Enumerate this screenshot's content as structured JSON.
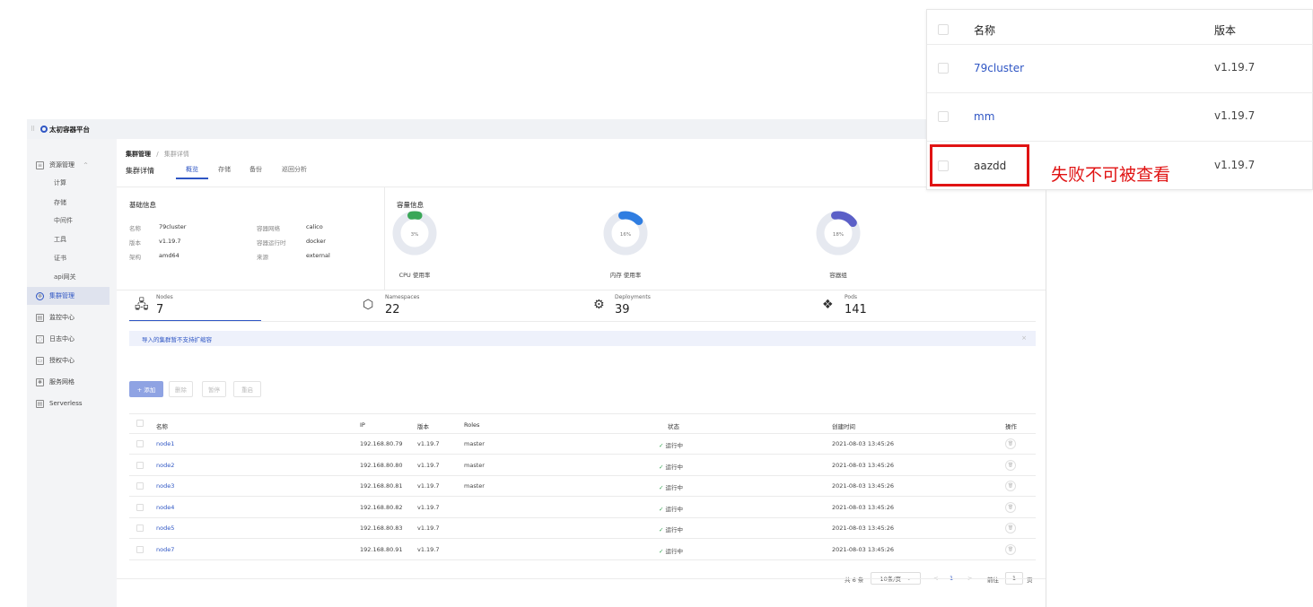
{
  "app": {
    "title": "太初容器平台"
  },
  "sidebar": {
    "items": [
      {
        "label": "资源管理",
        "icon": "sliders-icon",
        "expanded": true
      },
      {
        "label": "计算",
        "sub": true
      },
      {
        "label": "存储",
        "sub": true
      },
      {
        "label": "中间件",
        "sub": true
      },
      {
        "label": "工具",
        "sub": true
      },
      {
        "label": "证书",
        "sub": true
      },
      {
        "label": "api网关",
        "sub": true
      },
      {
        "label": "集群管理",
        "icon": "cluster-icon",
        "active": true
      },
      {
        "label": "监控中心",
        "icon": "monitor-icon"
      },
      {
        "label": "日志中心",
        "icon": "bell-icon"
      },
      {
        "label": "授权中心",
        "icon": "key-icon"
      },
      {
        "label": "服务网格",
        "icon": "mesh-icon"
      },
      {
        "label": "Serverless",
        "icon": "serverless-icon"
      }
    ]
  },
  "breadcrumb": {
    "root": "集群管理",
    "separator": "/",
    "current": "集群详情"
  },
  "page": {
    "title": "集群详情",
    "tabs": [
      "概览",
      "存储",
      "备份",
      "巡回分析"
    ],
    "active_tab": 0
  },
  "basic_info": {
    "title": "基础信息",
    "fields": [
      {
        "k": "名称",
        "v": "79cluster"
      },
      {
        "k": "版本",
        "v": "v1.19.7"
      },
      {
        "k": "架构",
        "v": "amd64"
      },
      {
        "k": "容器网络",
        "v": "calico"
      },
      {
        "k": "容器运行时",
        "v": "docker"
      },
      {
        "k": "来源",
        "v": "external"
      }
    ]
  },
  "capacity": {
    "title": "容量信息",
    "donuts": [
      {
        "label": "CPU 使用率",
        "pct_text": "3%",
        "value": 0.03,
        "color": "#3aa757"
      },
      {
        "label": "内存 使用率",
        "pct_text": "16%",
        "value": 0.16,
        "color": "#2f7de1"
      },
      {
        "label": "容器组",
        "pct_text": "18%",
        "value": 0.18,
        "color": "#5b5fc7"
      }
    ]
  },
  "stats": [
    {
      "label": "Nodes",
      "value": "7",
      "icon": "nodes-icon"
    },
    {
      "label": "Namespaces",
      "value": "22",
      "icon": "namespace-icon"
    },
    {
      "label": "Deployments",
      "value": "39",
      "icon": "gear-icon"
    },
    {
      "label": "Pods",
      "value": "141",
      "icon": "pods-icon"
    }
  ],
  "notice": {
    "text": "导入的集群暂不支持扩缩容",
    "close": "×"
  },
  "actions": {
    "add": "+ 添加",
    "delete": "删除",
    "cordon": "暂停",
    "uncordon": "重启"
  },
  "table": {
    "headers": [
      "名称",
      "IP",
      "版本",
      "Roles",
      "状态",
      "创建时间",
      "操作"
    ],
    "rows": [
      {
        "name": "node1",
        "ip": "192.168.80.79",
        "version": "v1.19.7",
        "roles": "master",
        "status": "运行中",
        "created": "2021-08-03 13:45:26"
      },
      {
        "name": "node2",
        "ip": "192.168.80.80",
        "version": "v1.19.7",
        "roles": "master",
        "status": "运行中",
        "created": "2021-08-03 13:45:26"
      },
      {
        "name": "node3",
        "ip": "192.168.80.81",
        "version": "v1.19.7",
        "roles": "master",
        "status": "运行中",
        "created": "2021-08-03 13:45:26"
      },
      {
        "name": "node4",
        "ip": "192.168.80.82",
        "version": "v1.19.7",
        "roles": "",
        "status": "运行中",
        "created": "2021-08-03 13:45:26"
      },
      {
        "name": "node5",
        "ip": "192.168.80.83",
        "version": "v1.19.7",
        "roles": "",
        "status": "运行中",
        "created": "2021-08-03 13:45:26"
      },
      {
        "name": "node7",
        "ip": "192.168.80.91",
        "version": "v1.19.7",
        "roles": "",
        "status": "运行中",
        "created": "2021-08-03 13:45:26"
      }
    ]
  },
  "pagination": {
    "total": "共 6 条",
    "page_size": "10条/页",
    "prev": "<",
    "page": "1",
    "next": ">",
    "goto_label": "前往",
    "goto_value": "1",
    "page_unit": "页"
  },
  "zoom_panel": {
    "headers": {
      "name": "名称",
      "version": "版本"
    },
    "rows": [
      {
        "name": "79cluster",
        "version": "v1.19.7"
      },
      {
        "name": "mm",
        "version": "v1.19.7"
      },
      {
        "name": "aazdd",
        "version": "v1.19.7"
      }
    ]
  },
  "annotation": {
    "text": "失败不可被查看",
    "color": "#e01313"
  }
}
